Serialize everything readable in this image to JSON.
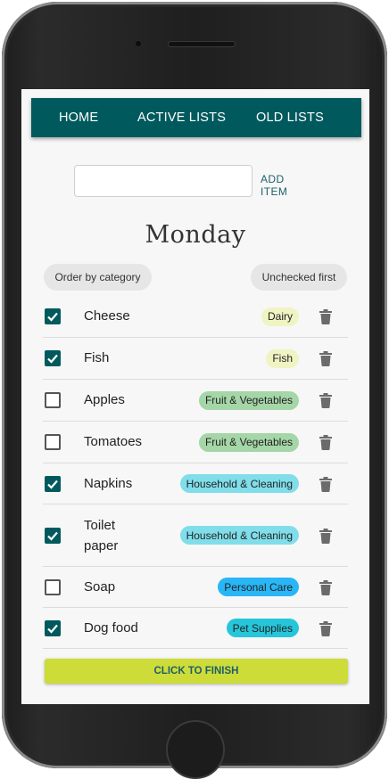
{
  "nav": {
    "home": "HOME",
    "active_lists": "ACTIVE LISTS",
    "old_lists": "OLD LISTS"
  },
  "add_item": {
    "input_value": "",
    "button_label": "ADD ITEM"
  },
  "list": {
    "title": "Monday"
  },
  "controls": {
    "order_label": "Order by category",
    "unchecked_label": "Unchecked first"
  },
  "items": [
    {
      "name": "Cheese",
      "checked": true,
      "category": "Dairy",
      "category_color": "#f0f4c3"
    },
    {
      "name": "Fish",
      "checked": true,
      "category": "Fish",
      "category_color": "#f0f4c3"
    },
    {
      "name": "Apples",
      "checked": false,
      "category": "Fruit & Vegetables",
      "category_color": "#a5d6a7"
    },
    {
      "name": "Tomatoes",
      "checked": false,
      "category": "Fruit & Vegetables",
      "category_color": "#a5d6a7"
    },
    {
      "name": "Napkins",
      "checked": true,
      "category": "Household & Cleaning",
      "category_color": "#80deea"
    },
    {
      "name": "Toilet paper",
      "checked": true,
      "category": "Household & Cleaning",
      "category_color": "#80deea"
    },
    {
      "name": "Soap",
      "checked": false,
      "category": "Personal Care",
      "category_color": "#29b6f6"
    },
    {
      "name": "Dog food",
      "checked": true,
      "category": "Pet Supplies",
      "category_color": "#26c6da"
    }
  ],
  "finish_button": "CLICK TO FINISH",
  "colors": {
    "nav": "#005a5d",
    "checkbox_on": "#005a5d",
    "finish": "#cddc38",
    "accent_text": "#1e5f6b"
  },
  "icons": {
    "delete": "trash-icon",
    "check": "check-icon"
  }
}
